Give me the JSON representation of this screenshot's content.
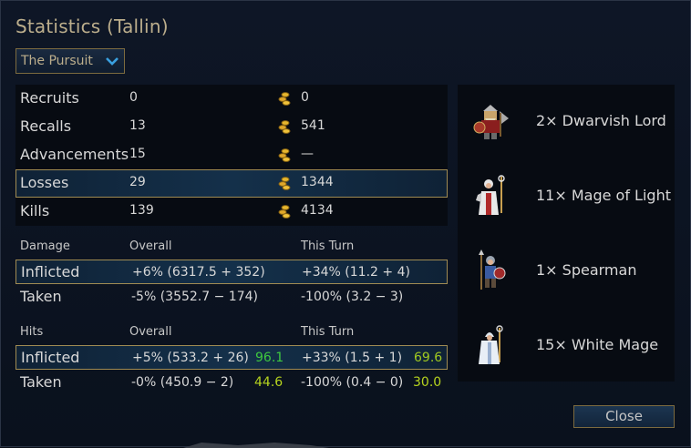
{
  "title": "Statistics (Tallin)",
  "scenario_select": {
    "value": "The Pursuit"
  },
  "summary": [
    {
      "label": "Recruits",
      "count": "0",
      "gold": "0",
      "highlight": false
    },
    {
      "label": "Recalls",
      "count": "13",
      "gold": "541",
      "highlight": false
    },
    {
      "label": "Advancements",
      "count": "15",
      "gold": "—",
      "highlight": false
    },
    {
      "label": "Losses",
      "count": "29",
      "gold": "1344",
      "highlight": true
    },
    {
      "label": "Kills",
      "count": "139",
      "gold": "4134",
      "highlight": false
    }
  ],
  "damage": {
    "header": "Damage",
    "col_overall": "Overall",
    "col_turn": "This Turn",
    "rows": [
      {
        "label": "Inflicted",
        "overall": "+6% (6317.5 + 352)",
        "turn": "+34% (11.2 + 4)"
      },
      {
        "label": "Taken",
        "overall": "-5% (3552.7 − 174)",
        "turn": "-100% (3.2 − 3)"
      }
    ]
  },
  "hits": {
    "header": "Hits",
    "col_overall": "Overall",
    "col_turn": "This Turn",
    "rows": [
      {
        "label": "Inflicted",
        "overall": "+5% (533.2 + 26)",
        "overall_pct": "96.1",
        "turn": "+33% (1.5 + 1)",
        "turn_pct": "69.6"
      },
      {
        "label": "Taken",
        "overall": "-0% (450.9 − 2)",
        "overall_pct": "44.6",
        "turn": "-100% (0.4 − 0)",
        "turn_pct": "30.0"
      }
    ]
  },
  "units": [
    {
      "name": "2× Dwarvish Lord",
      "icon": "dwarvish-lord-sprite"
    },
    {
      "name": "11× Mage of Light",
      "icon": "mage-of-light-sprite"
    },
    {
      "name": "1× Spearman",
      "icon": "spearman-sprite"
    },
    {
      "name": "15× White Mage",
      "icon": "white-mage-sprite"
    }
  ],
  "colors": {
    "pct_green": "#3fc83f",
    "pct_yellowgreen": "#b6d41e",
    "pct_olive": "#a0c820"
  },
  "close_label": "Close"
}
